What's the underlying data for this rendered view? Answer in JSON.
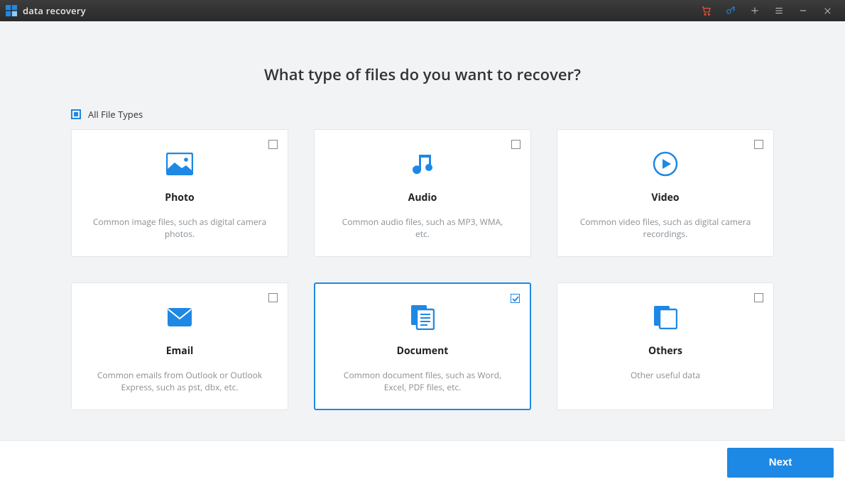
{
  "app": {
    "title": "data recovery"
  },
  "heading": "What type of files do you want to recover?",
  "allFileTypesLabel": "All File Types",
  "cards": {
    "photo": {
      "title": "Photo",
      "desc": "Common image files, such as digital camera photos.",
      "selected": false
    },
    "audio": {
      "title": "Audio",
      "desc": "Common audio files, such as MP3, WMA, etc.",
      "selected": false
    },
    "video": {
      "title": "Video",
      "desc": "Common video files, such as digital camera recordings.",
      "selected": false
    },
    "email": {
      "title": "Email",
      "desc": "Common emails from Outlook or Outlook Express, such as pst, dbx, etc.",
      "selected": false
    },
    "document": {
      "title": "Document",
      "desc": "Common document files, such as Word, Excel, PDF files, etc.",
      "selected": true
    },
    "others": {
      "title": "Others",
      "desc": "Other useful data",
      "selected": false
    }
  },
  "footer": {
    "nextLabel": "Next"
  }
}
